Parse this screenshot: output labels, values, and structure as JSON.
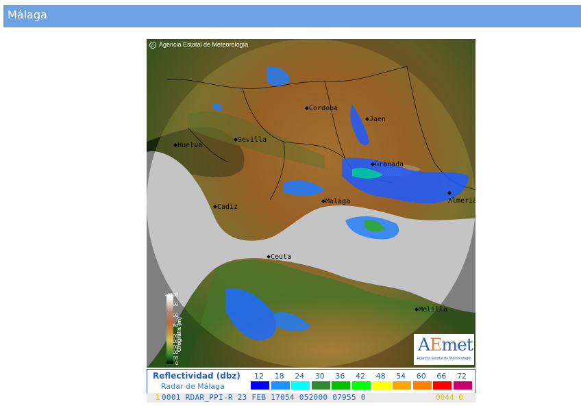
{
  "header": {
    "title": "Málaga"
  },
  "map": {
    "copyright": "Agencia Estatal de Meteorología",
    "cities": [
      {
        "id": "cordoba",
        "name": "Cordoba"
      },
      {
        "id": "jaen",
        "name": "Jaen"
      },
      {
        "id": "huelva",
        "name": "Huelva"
      },
      {
        "id": "sevilla",
        "name": "Sevilla"
      },
      {
        "id": "granada",
        "name": "Granada"
      },
      {
        "id": "almeria",
        "name": "Almeria"
      },
      {
        "id": "cadiz",
        "name": "Cadiz"
      },
      {
        "id": "malaga",
        "name": "Malaga"
      },
      {
        "id": "ceuta",
        "name": "Ceuta"
      },
      {
        "id": "melilla",
        "name": "Melilla"
      }
    ],
    "orography": {
      "title": "Orografía (m)",
      "labels": [
        ">2500",
        "2000",
        "1500",
        "1250",
        "1000",
        "800",
        "600",
        "400",
        "200",
        "0"
      ]
    },
    "logo": {
      "text_a": "A",
      "text_b": "E",
      "text_c": "met",
      "subtitle": "Agencia Estatal de Meteorología"
    }
  },
  "legend": {
    "title": "Reflectividad (dbz)",
    "subtitle": "Radar de Málaga",
    "scale": [
      {
        "value": "12",
        "color": "#0000ff"
      },
      {
        "value": "18",
        "color": "#1e90ff"
      },
      {
        "value": "24",
        "color": "#00ffff"
      },
      {
        "value": "30",
        "color": "#2f8a2f"
      },
      {
        "value": "36",
        "color": "#00c000"
      },
      {
        "value": "42",
        "color": "#00ff00"
      },
      {
        "value": "48",
        "color": "#ffff00"
      },
      {
        "value": "54",
        "color": "#ffa500"
      },
      {
        "value": "60",
        "color": "#ff7f00"
      },
      {
        "value": "66",
        "color": "#ff0000"
      },
      {
        "value": "72",
        "color": "#c8006e"
      }
    ]
  },
  "status": {
    "line": "0001 RDAR_PPI-R   23 FEB 17054 052000 07955 0",
    "flag": "1",
    "tail": "0044 0"
  }
}
